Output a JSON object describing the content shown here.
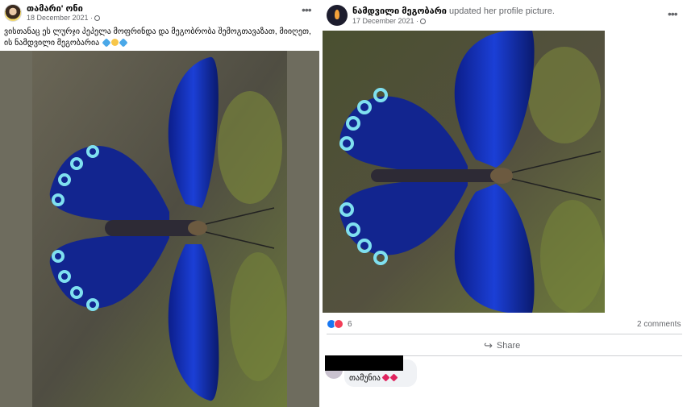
{
  "left_post": {
    "author": "თამარი' ონი",
    "date": "18 December 2021 ·",
    "caption": "ვისთანაც ეს ლურჯი პეპელა მოფრინდა და მეგობრობა შემოგთავაზათ, მიიღეთ, ის ნამდვილი მეგობარია",
    "caption_emoji": [
      "blue-heart",
      "smiling-face",
      "blue-heart"
    ]
  },
  "right_post": {
    "author": "ნამდვილი მეგობარი",
    "action": "updated her profile picture.",
    "date": "17 December 2021 ·",
    "reaction_count": "6",
    "comments_label": "2 comments",
    "share_label": "Share",
    "comment_text": "თამუნია",
    "comment_emoji": [
      "red-heart",
      "red-heart"
    ]
  },
  "colors": {
    "wing_blue": "#1b3fd6",
    "wing_spots": "#7fe0f0",
    "bark": "#5b5a4c",
    "moss": "#7d8a3a",
    "like_blue": "#1877f2",
    "love_red": "#f33e58"
  }
}
